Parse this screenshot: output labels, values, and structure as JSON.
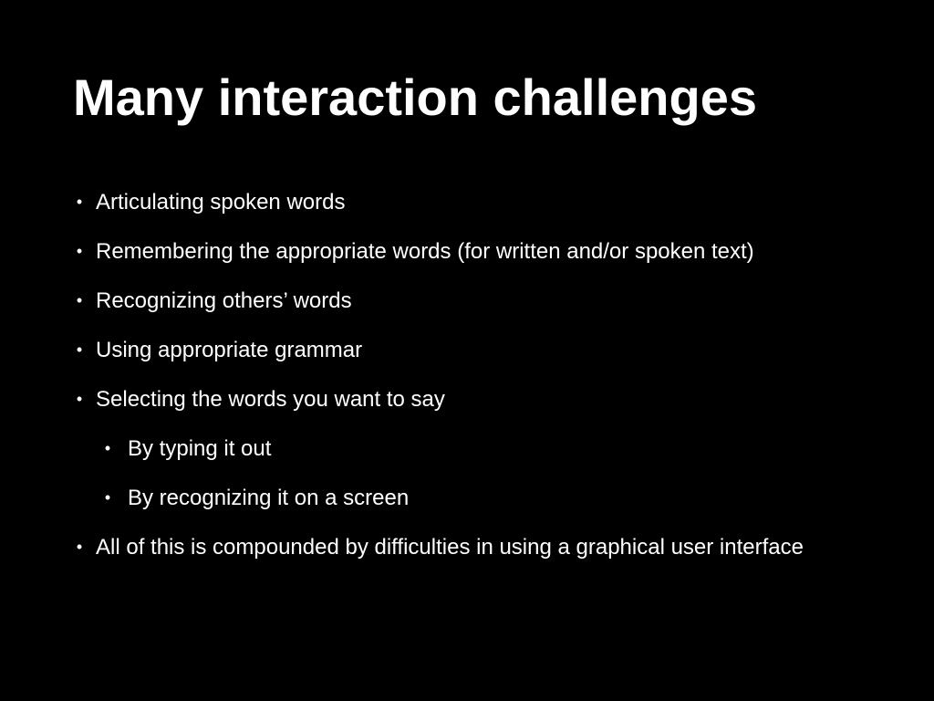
{
  "slide": {
    "title": "Many interaction challenges",
    "bullet_glyph": "•",
    "bullets": [
      {
        "text": "Articulating spoken words",
        "level": 1
      },
      {
        "text": "Remembering the appropriate words (for written and/or spoken text)",
        "level": 1
      },
      {
        "text": "Recognizing others’ words",
        "level": 1
      },
      {
        "text": "Using appropriate grammar",
        "level": 1
      },
      {
        "text": "Selecting the words you want to say",
        "level": 1
      },
      {
        "text": "By typing it out",
        "level": 2
      },
      {
        "text": "By recognizing it on a screen",
        "level": 2
      },
      {
        "text": "All of this is compounded by difficulties in using a graphical user interface",
        "level": 1
      }
    ]
  },
  "colors": {
    "background": "#000000",
    "text": "#ffffff"
  }
}
